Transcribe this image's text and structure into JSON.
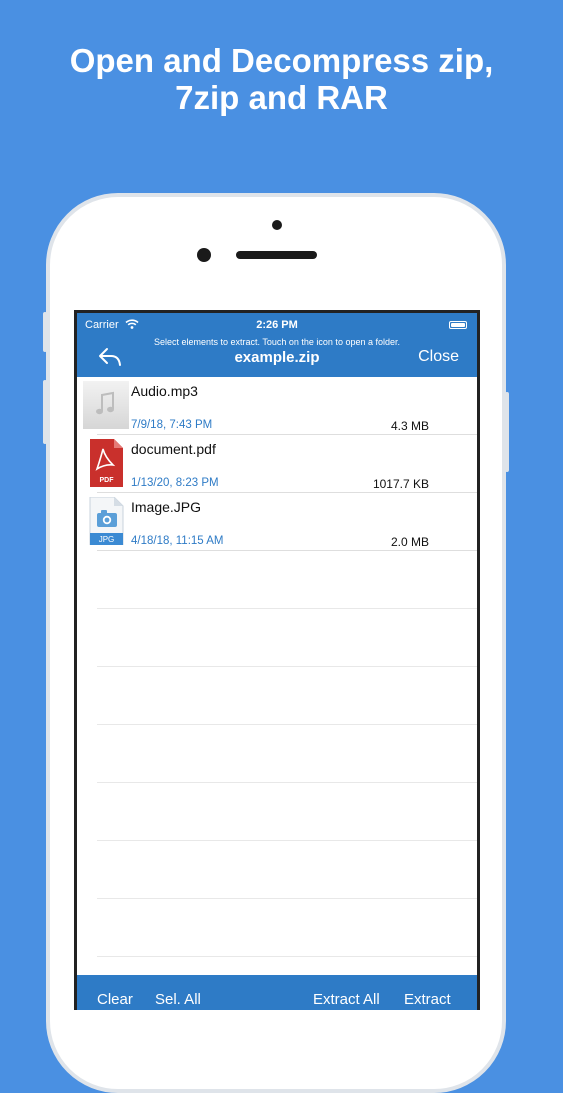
{
  "headline": {
    "line1": "Open and Decompress zip,",
    "line2": "7zip and RAR"
  },
  "status": {
    "carrier": "Carrier",
    "time": "2:26 PM"
  },
  "navbar": {
    "hint": "Select elements to extract. Touch on the icon to open a folder.",
    "title": "example.zip",
    "close_label": "Close"
  },
  "files": [
    {
      "name": "Audio.mp3",
      "date": "7/9/18, 7:43 PM",
      "size": "4.3 MB",
      "icon": "music-file-icon"
    },
    {
      "name": "document.pdf",
      "date": "1/13/20, 8:23 PM",
      "size": "1017.7 KB",
      "icon": "pdf-file-icon",
      "badge": "PDF"
    },
    {
      "name": "Image.JPG",
      "date": "4/18/18, 11:15 AM",
      "size": "2.0 MB",
      "icon": "image-file-icon",
      "badge": "JPG"
    }
  ],
  "toolbar": {
    "clear_label": "Clear",
    "select_all_label": "Sel. All",
    "extract_all_label": "Extract All",
    "extract_label": "Extract"
  },
  "colors": {
    "background": "#4a90e2",
    "bar": "#2e7bc6",
    "date_text": "#2e7bc6",
    "pdf_red": "#c9302c"
  }
}
